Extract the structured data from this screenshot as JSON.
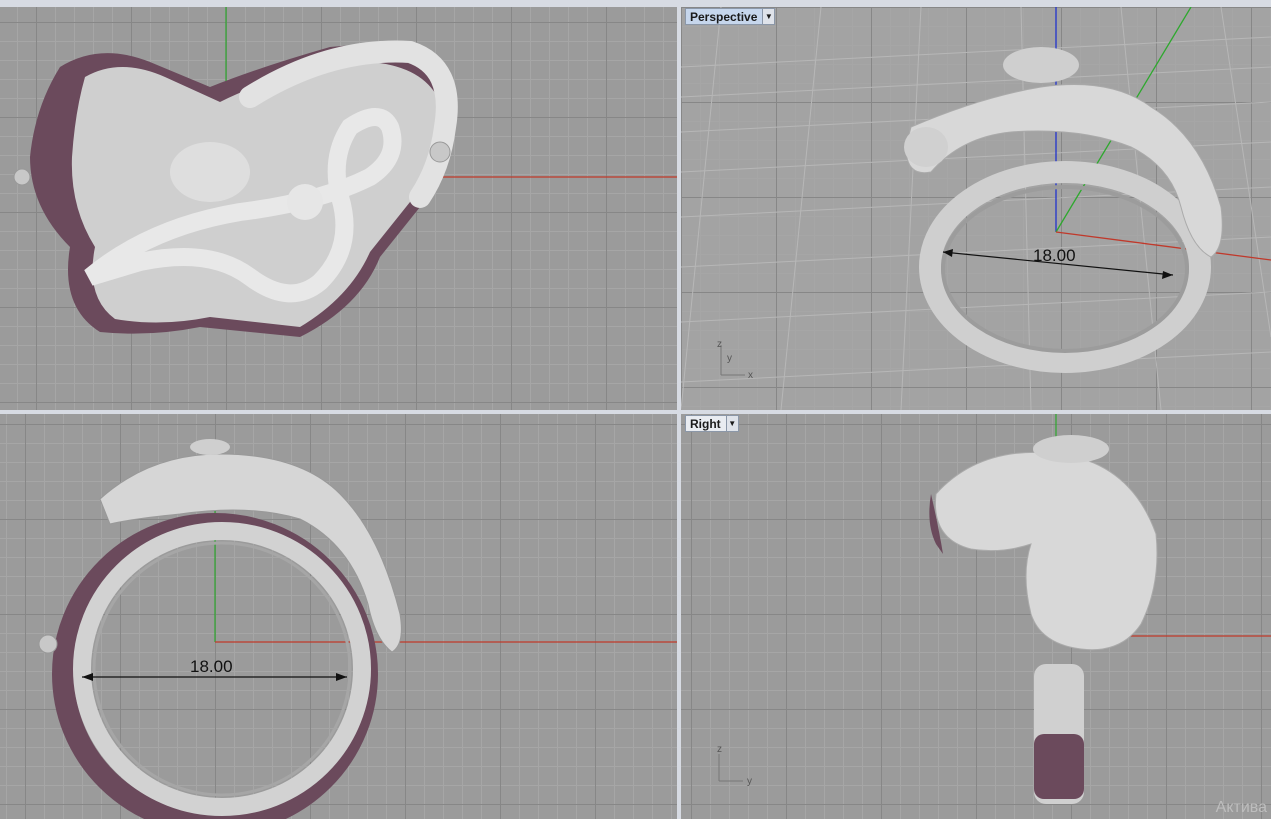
{
  "viewports": {
    "top": {
      "label": ""
    },
    "perspective": {
      "label": "Perspective",
      "dimension": "18.00",
      "axes": {
        "x": "x",
        "y": "y",
        "z": "z"
      }
    },
    "front": {
      "label": "",
      "dimension": "18.00"
    },
    "right": {
      "label": "Right",
      "axes": {
        "z": "z",
        "y": "y"
      }
    }
  },
  "watermark": "Актива",
  "colors": {
    "grid": "#9b9b9b",
    "x_axis": "#c0392b",
    "y_axis": "#2ea82e",
    "z_axis": "#2233cc",
    "model": "#d2d2d2",
    "model_shadow": "#6b4a5c"
  }
}
